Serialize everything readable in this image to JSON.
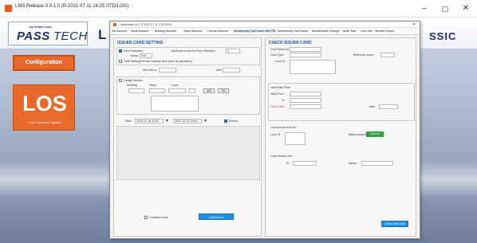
{
  "window": {
    "title": "LMS Release 0.0.1.0 (R-2021 07 11 16:25 STD/LOG)",
    "controls": [
      "–",
      "▢",
      "✕"
    ]
  },
  "branding": {
    "logo_small": "by Smart Lock",
    "logo_big": "PASS",
    "logo_tech": "TECH",
    "band_left": "L",
    "band_right": "SSIC"
  },
  "sidebar": {
    "configuration_label": "Configuration",
    "los_label": "LOS",
    "los_sub": "Lock Operation System"
  },
  "dialog": {
    "title": "Initialization (LIC R-2021 07 11 STD/LOG)",
    "close": "✕",
    "menu": [
      "Set Account",
      "Issue Account",
      "Building Account",
      "Setup Account",
      "License Account",
      "Membership Card Issue with PIN",
      "Membership Card Issue",
      "Maintenance Change",
      "Audit Trail",
      "Lock Info",
      "Member Import"
    ],
    "active_menu_index": 5
  },
  "left": {
    "heading": "ISSUER CARD SETTING",
    "floor_selection_label": "Floor Selection",
    "group_label": "Group",
    "group_value": "Gro...",
    "multi_lock_label": "Multi lock count for Floor Selection",
    "multi_lock_value": "1",
    "time_setting_label": "Time Setting(Set card validity time (such as question))",
    "set_time_label": "Set card to",
    "after_label": "after",
    "hedge_label": "Hedge Section",
    "building_label": "Building",
    "setup_label": "Setup",
    "level_label": "Level",
    "add_label": "Add",
    "del_label": "Del",
    "start_label": "Start",
    "start_value": "2019-11-18 10:00",
    "end_value": "2020-12-31 23:59",
    "extend_label": "Extend",
    "continue_label": "Continue Issue",
    "card_issue_label": "Card Issue"
  },
  "right": {
    "heading": "CHECK ISSUER CARD",
    "card_serial_label": "Card Serial No. :",
    "card_type_label": "Card Type :",
    "multi_lock_count_label": "Multi lock count :",
    "lock_id_label": "Lock ID :",
    "valid_date_time_label": "Valid Date/Time",
    "valid_from_label": "Valid From :",
    "to_label": "To :",
    "time_limit_label": "Time Limit :",
    "after_label": "after",
    "last_access_label": "Last access lock list",
    "lock_id2_label": "Lock ID :",
    "battery_label": "Battery status :",
    "battery_value": "Normal",
    "card_history_label": "Card History Info.",
    "id_label": "ID :",
    "name_label": "Name :",
    "check_btn_label": "Check User Card"
  },
  "colors": {
    "accent_orange": "#e9692b",
    "accent_blue": "#1f8fe8",
    "heading_blue": "#1d4fb0",
    "battery_green": "#2ea043"
  }
}
